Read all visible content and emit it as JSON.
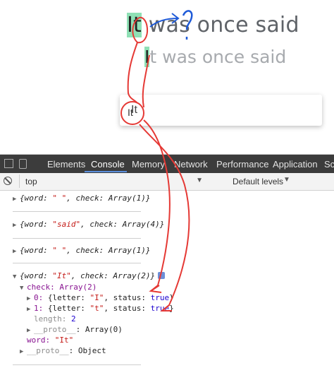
{
  "web": {
    "line1_highlight": "It",
    "line1_rest": " was once said",
    "line2_highlight": "I",
    "line2_rest": "t was once said",
    "box_text": "It"
  },
  "devtools": {
    "tabs": [
      "Elements",
      "Console",
      "Memory",
      "Network",
      "Performance",
      "Application",
      "Sc"
    ],
    "active_tab": "Console",
    "context": "top",
    "levels": "Default levels"
  },
  "console": {
    "rows": [
      {
        "text_a": "{word: ",
        "str": "\" \"",
        "text_b": ", check: Array(1)}"
      },
      {
        "text_a": "{word: ",
        "str": "\"said\"",
        "text_b": ", check: Array(4)}"
      },
      {
        "text_a": "{word: ",
        "str": "\" \"",
        "text_b": ", check: Array(1)}"
      },
      {
        "text_a": "{word: ",
        "str": "\"It\"",
        "text_b": ", check: Array(2)}"
      }
    ],
    "check_line": "check: Array(2)",
    "item0": {
      "idx": "0: ",
      "a": "{letter: ",
      "s": "\"I\"",
      "b": ", status: ",
      "v": "true",
      "c": "}"
    },
    "item1": {
      "idx": "1: ",
      "a": "{letter: ",
      "s": "\"t\"",
      "b": ", status: ",
      "v": "true",
      "c": "}"
    },
    "length_key": "length: ",
    "length_val": "2",
    "proto1_key": "__proto__",
    "proto1_val": ": Array(0)",
    "word_key": "word: ",
    "word_val": "\"It\"",
    "proto2_key": "__proto__",
    "proto2_val": ": Object"
  }
}
